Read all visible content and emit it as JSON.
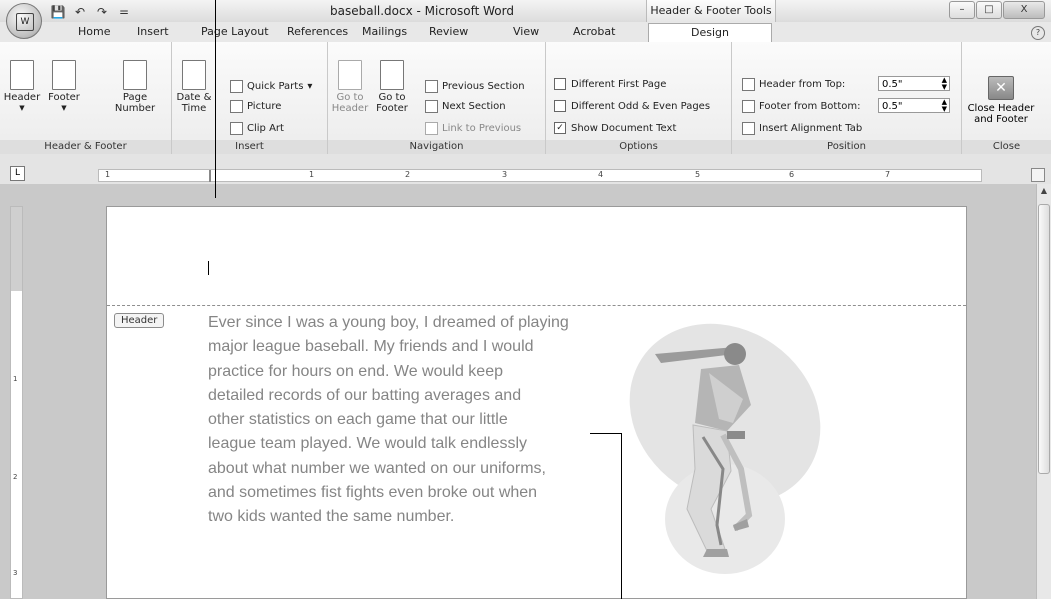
{
  "window": {
    "title": "baseball.docx - Microsoft Word",
    "context_tab": "Header & Footer Tools"
  },
  "window_controls": {
    "minimize": "–",
    "maximize": "□",
    "close": "X"
  },
  "office_button": {
    "logo": "W"
  },
  "quick_access": {
    "save_icon": "💾",
    "undo_icon": "↶",
    "redo_icon": "↷",
    "customize_icon": "="
  },
  "tabs": [
    "Home",
    "Insert",
    "Page Layout",
    "References",
    "Mailings",
    "Review",
    "View",
    "Acrobat",
    "Design"
  ],
  "help_icon": "?",
  "ribbon": {
    "header_footer": {
      "label": "Header & Footer",
      "header": "Header",
      "footer": "Footer",
      "page_number": "Page Number"
    },
    "insert": {
      "label": "Insert",
      "date_time": "Date & Time",
      "quick_parts": "Quick Parts",
      "picture": "Picture",
      "clip_art": "Clip Art"
    },
    "navigation": {
      "label": "Navigation",
      "go_to_header": "Go to Header",
      "go_to_footer": "Go to Footer",
      "previous_section": "Previous Section",
      "next_section": "Next Section",
      "link_to_previous": "Link to Previous"
    },
    "options": {
      "label": "Options",
      "different_first_page": "Different First Page",
      "different_odd_even": "Different Odd & Even Pages",
      "show_document_text": "Show Document Text",
      "different_first_page_checked": false,
      "different_odd_even_checked": false,
      "show_document_text_checked": true
    },
    "position": {
      "label": "Position",
      "header_from_top_label": "Header from Top:",
      "header_from_top_value": "0.5\"",
      "footer_from_bottom_label": "Footer from Bottom:",
      "footer_from_bottom_value": "0.5\"",
      "insert_alignment_tab": "Insert Alignment Tab"
    },
    "close": {
      "label": "Close",
      "close_header_footer": "Close Header and Footer"
    }
  },
  "ruler": {
    "tab_selector": "L",
    "numbers": [
      "1",
      "1",
      "2",
      "3",
      "4",
      "5",
      "6",
      "7"
    ]
  },
  "vertical_ruler": {
    "numbers": [
      "1",
      "2",
      "3"
    ]
  },
  "document": {
    "header_tag": "Header",
    "lines": [
      "Ever since I was a young boy, I dreamed of playing",
      "major league baseball.  My friends and I would",
      "practice for hours on end. We would keep",
      "detailed records of our batting averages and",
      "other statistics on each game that our little",
      "league team played.  We would talk endlessly",
      "about what number we wanted on our uniforms,",
      "and sometimes fist fights even broke out when",
      "two kids wanted the same number."
    ]
  },
  "colors": {
    "body_text": "#858585",
    "header_dashes": "#8f8f8f"
  }
}
